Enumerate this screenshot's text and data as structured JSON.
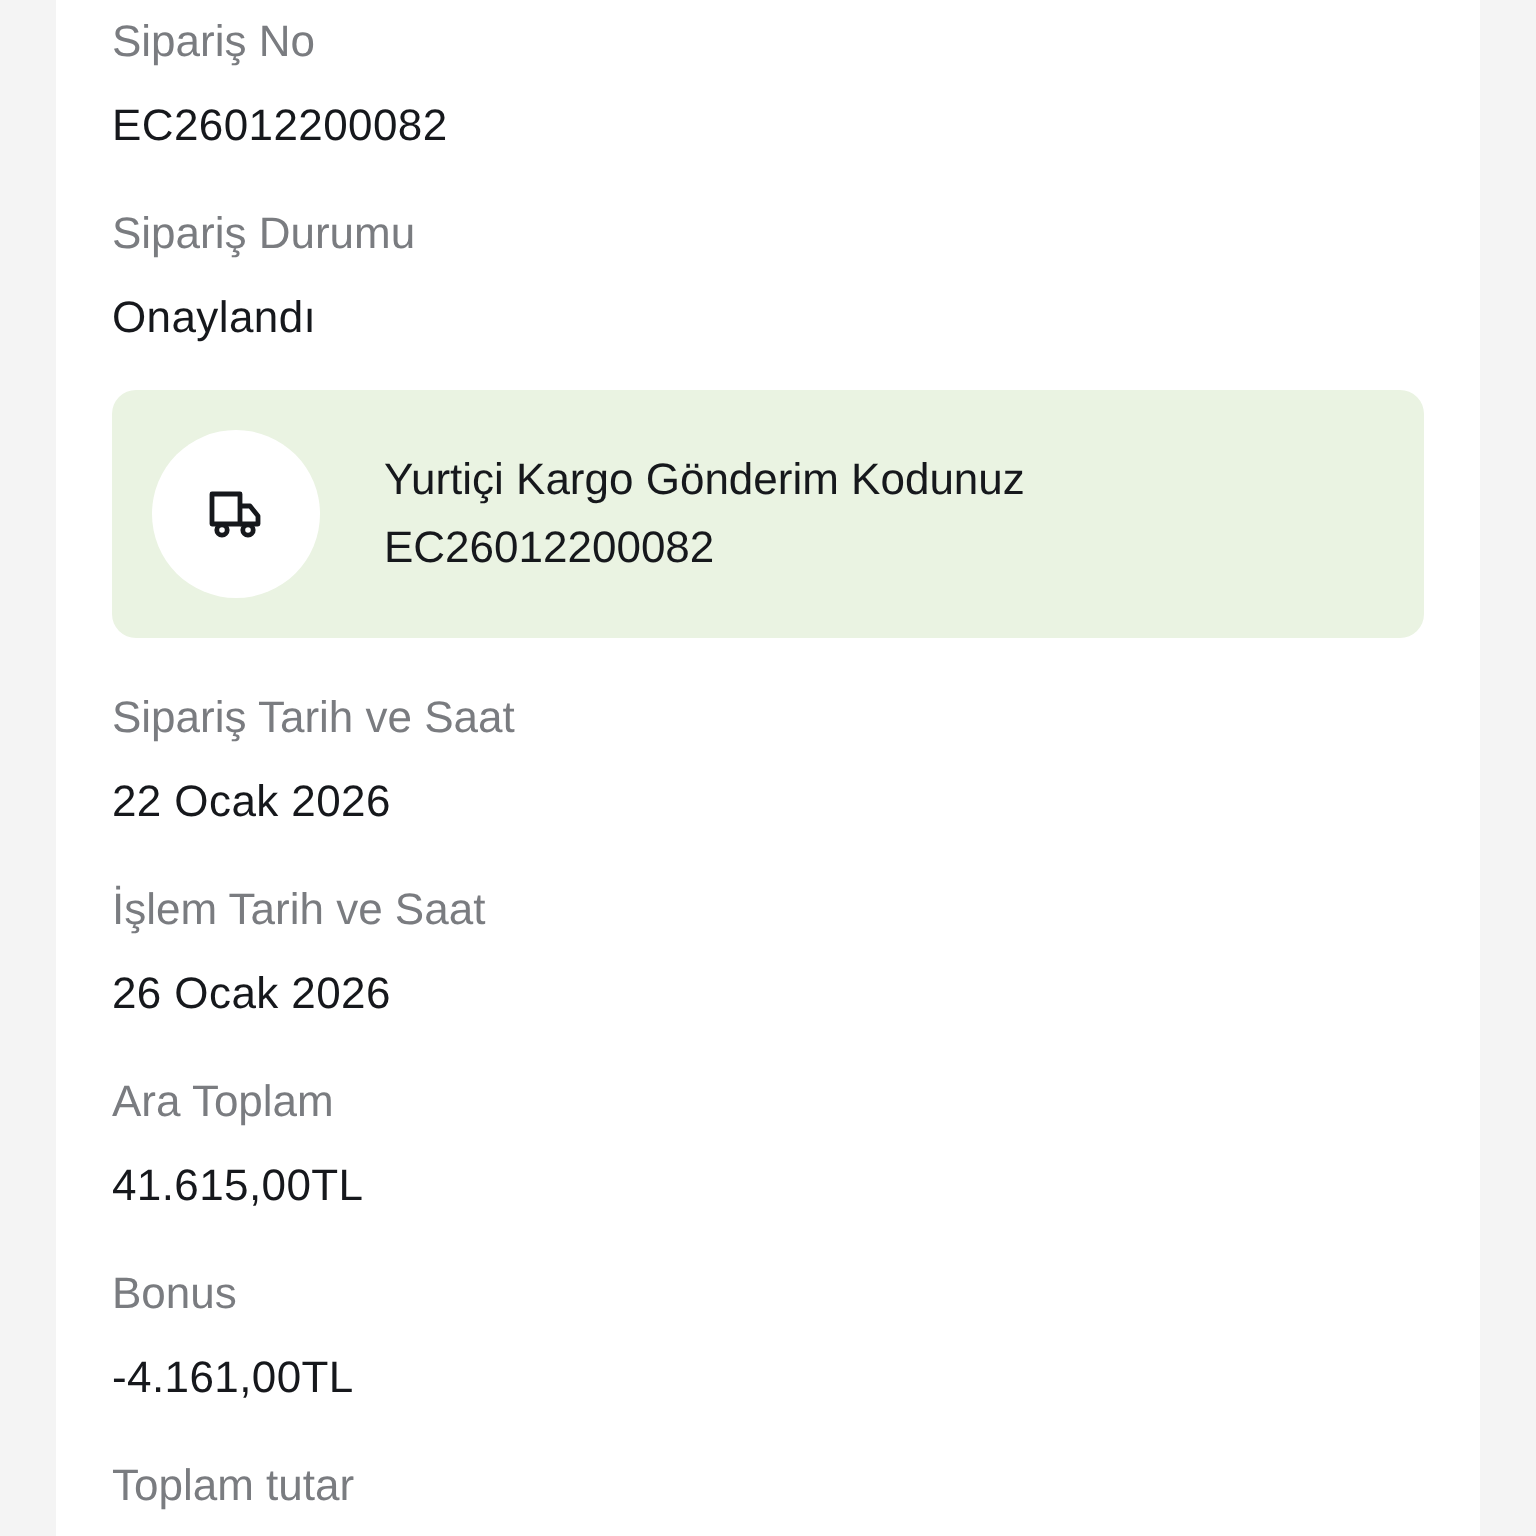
{
  "details": [
    {
      "kind": "field",
      "label": "Sipariş No",
      "value": "EC26012200082"
    },
    {
      "kind": "field",
      "label": "Sipariş Durumu",
      "value": "Onaylandı"
    },
    {
      "kind": "shipment",
      "title": "Yurtiçi Kargo Gönderim Kodunuz",
      "code": "EC26012200082"
    },
    {
      "kind": "field",
      "label": "Sipariş Tarih ve Saat",
      "value": "22 Ocak 2026"
    },
    {
      "kind": "field",
      "label": "İşlem Tarih ve Saat",
      "value": "26 Ocak 2026"
    },
    {
      "kind": "field",
      "label": "Ara Toplam",
      "value": "41.615,00TL"
    },
    {
      "kind": "field",
      "label": "Bonus",
      "value": "-4.161,00TL"
    },
    {
      "kind": "field",
      "label": "Toplam tutar"
    }
  ]
}
